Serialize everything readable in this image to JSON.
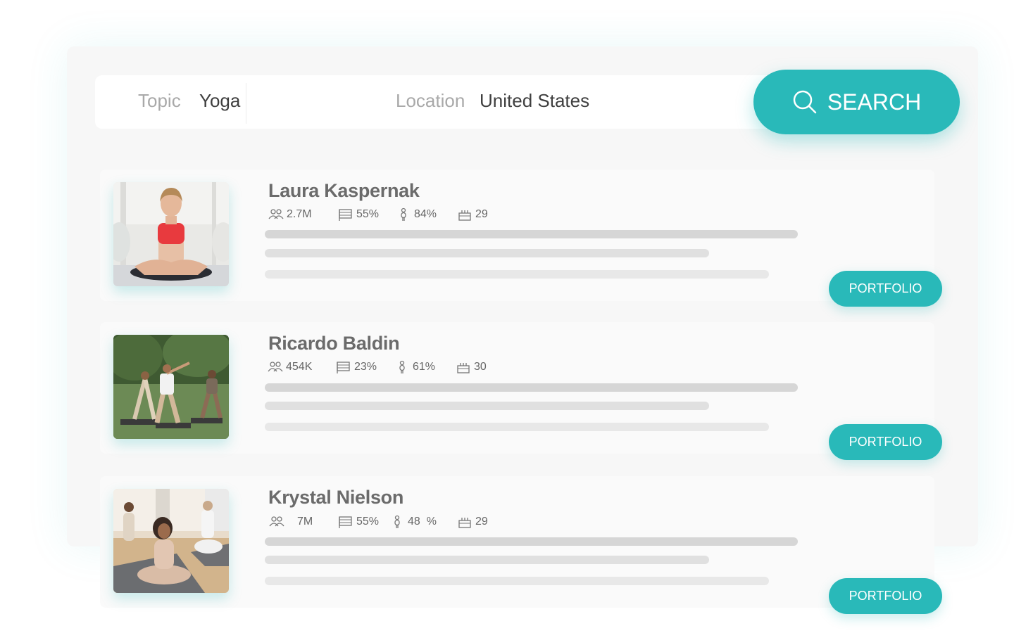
{
  "search": {
    "topic_label": "Topic",
    "topic_value": "Yoga",
    "location_label": "Location",
    "location_value": "United States",
    "button_label": "SEARCH"
  },
  "influencers": [
    {
      "name": "Laura Kaspernak",
      "followers": "2.7M",
      "country_pct": "55%",
      "gender_pct": "84%",
      "age": "29",
      "button_label": "PORTFOLIO"
    },
    {
      "name": "Ricardo Baldin",
      "followers": "454K",
      "country_pct": "23%",
      "gender_pct": "61%",
      "age": "30",
      "button_label": "PORTFOLIO"
    },
    {
      "name": "Krystal Nielson",
      "followers": "7M",
      "country_pct": "55%",
      "gender_pct": "48  %",
      "age": "29",
      "button_label": "PORTFOLIO"
    }
  ],
  "icons": {
    "search": "search-icon",
    "followers": "people-icon",
    "country": "flag-icon",
    "gender": "person-icon",
    "age": "cake-icon"
  },
  "colors": {
    "accent": "#29b9b9",
    "panel": "#f7f7f7",
    "card": "#fafafa"
  }
}
